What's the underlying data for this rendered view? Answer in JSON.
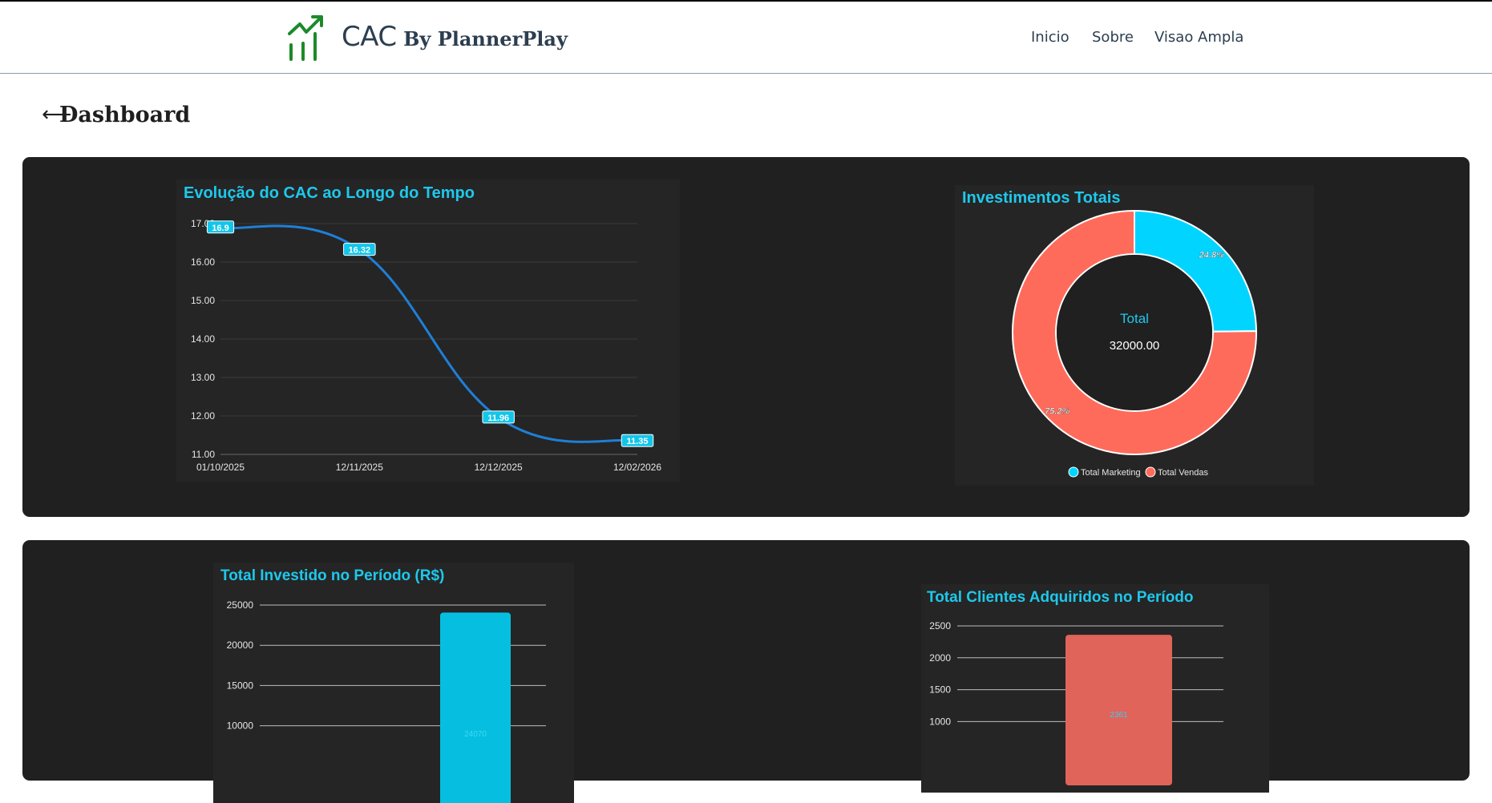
{
  "brand": {
    "name": "CAC",
    "sub": "By PlannerPlay"
  },
  "nav": {
    "items": [
      "Inicio",
      "Sobre",
      "Visao Ampla"
    ]
  },
  "page": {
    "back_icon": "arrow-left-icon",
    "title": "Dashboard"
  },
  "colors": {
    "accent": "#1ec8ec",
    "marketing": "#00d4ff",
    "vendas": "#ff6b5b",
    "line": "#1f7fd6",
    "panel": "#202020"
  },
  "charts": {
    "cac": {
      "title": "Evolução do CAC ao Longo do Tempo",
      "chart_data": {
        "type": "line",
        "x": [
          "01/10/2025",
          "12/11/2025",
          "12/12/2025",
          "12/02/2026"
        ],
        "series": [
          {
            "values": [
              16.9,
              16.32,
              11.96,
              11.35
            ]
          }
        ],
        "data_labels": [
          "16.9",
          "16.32",
          "11.96",
          "11.35"
        ],
        "y_ticks": [
          "17.00",
          "16.00",
          "15.00",
          "14.00",
          "13.00",
          "12.00",
          "11.00"
        ],
        "ylim": [
          11,
          17
        ],
        "grid": true
      }
    },
    "invest": {
      "title": "Investimentos Totais",
      "center_label": "Total",
      "center_value": "32000.00",
      "chart_data": {
        "type": "pie",
        "labels": [
          "Total Marketing",
          "Total Vendas"
        ],
        "percent_labels": [
          "24.8%",
          "75.2%"
        ],
        "values": [
          24.8,
          75.2
        ],
        "legend": "bottom"
      }
    },
    "total_invest": {
      "title": "Total Investido no Período (R$)",
      "chart_data": {
        "type": "bar",
        "categories": [
          ""
        ],
        "values": [
          24070
        ],
        "value_label": "24070",
        "y_ticks": [
          "25000",
          "20000",
          "15000",
          "10000"
        ],
        "ylim": [
          0,
          25000
        ],
        "grid": true
      }
    },
    "total_clients": {
      "title": "Total Clientes Adquiridos no Período",
      "chart_data": {
        "type": "bar",
        "categories": [
          ""
        ],
        "values": [
          2361
        ],
        "value_label": "2361",
        "y_ticks": [
          "2500",
          "2000",
          "1500",
          "1000"
        ],
        "ylim": [
          0,
          2500
        ],
        "grid": true
      }
    }
  }
}
